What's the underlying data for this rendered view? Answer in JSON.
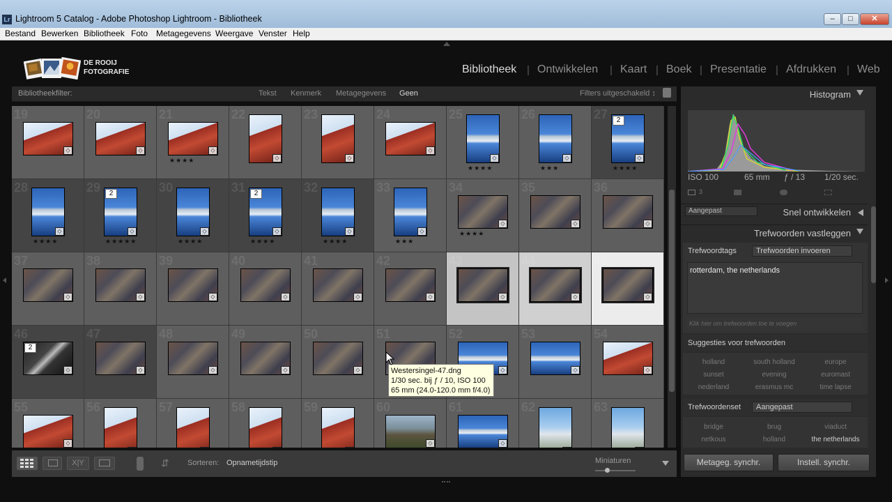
{
  "window": {
    "title": "Lightroom 5 Catalog - Adobe Photoshop Lightroom - Bibliotheek",
    "app_icon": "Lr"
  },
  "menu": [
    "Bestand",
    "Bewerken",
    "Bibliotheek",
    "Foto",
    "Metagegevens",
    "Weergave",
    "Venster",
    "Help"
  ],
  "identity": {
    "line1": "DE ROOIJ",
    "line2": "FOTOGRAFIE"
  },
  "modules": [
    "Bibliotheek",
    "Ontwikkelen",
    "Kaart",
    "Boek",
    "Presentatie",
    "Afdrukken",
    "Web"
  ],
  "active_module": "Bibliotheek",
  "filterbar": {
    "label": "Bibliotheekfilter:",
    "tabs": [
      "Tekst",
      "Kenmerk",
      "Metagegevens",
      "Geen"
    ],
    "active_tab": "Geen",
    "preset": "Filters uitgeschakeld ↕"
  },
  "grid": {
    "rows": [
      [
        {
          "n": "19",
          "style": "red",
          "orient": "land",
          "stars": "",
          "badge": ""
        },
        {
          "n": "20",
          "style": "red",
          "orient": "land",
          "stars": "",
          "badge": ""
        },
        {
          "n": "21",
          "style": "red",
          "orient": "land",
          "stars": "★★★★",
          "badge": ""
        },
        {
          "n": "22",
          "style": "red",
          "orient": "port",
          "stars": "",
          "badge": ""
        },
        {
          "n": "23",
          "style": "red",
          "orient": "port",
          "stars": "",
          "badge": ""
        },
        {
          "n": "24",
          "style": "red",
          "orient": "land",
          "stars": "",
          "badge": ""
        },
        {
          "n": "25",
          "style": "blue",
          "orient": "port",
          "stars": "★★★★",
          "badge": ""
        },
        {
          "n": "26",
          "style": "blue",
          "orient": "port",
          "stars": "★★★",
          "badge": ""
        },
        {
          "n": "27",
          "style": "blue",
          "orient": "port",
          "stars": "★★★★",
          "badge": "2"
        }
      ],
      [
        {
          "n": "28",
          "style": "blue",
          "orient": "port",
          "stars": "★★★★",
          "badge": ""
        },
        {
          "n": "29",
          "style": "blue",
          "orient": "port",
          "stars": "★★★★★",
          "badge": "2"
        },
        {
          "n": "30",
          "style": "blue",
          "orient": "port",
          "stars": "★★★★",
          "badge": ""
        },
        {
          "n": "31",
          "style": "blue",
          "orient": "port",
          "stars": "★★★★",
          "badge": "2"
        },
        {
          "n": "32",
          "style": "blue",
          "orient": "port",
          "stars": "★★★★",
          "badge": ""
        },
        {
          "n": "33",
          "style": "blue",
          "orient": "port",
          "stars": "★★★",
          "badge": ""
        },
        {
          "n": "34",
          "style": "glass",
          "orient": "land",
          "stars": "★★★★",
          "badge": ""
        },
        {
          "n": "35",
          "style": "glass",
          "orient": "land",
          "stars": "",
          "badge": ""
        },
        {
          "n": "36",
          "style": "glass",
          "orient": "land",
          "stars": "",
          "badge": ""
        }
      ],
      [
        {
          "n": "37",
          "style": "glass",
          "orient": "land",
          "stars": "",
          "badge": ""
        },
        {
          "n": "38",
          "style": "glass",
          "orient": "land",
          "stars": "",
          "badge": ""
        },
        {
          "n": "39",
          "style": "glass",
          "orient": "land",
          "stars": "",
          "badge": ""
        },
        {
          "n": "40",
          "style": "glass",
          "orient": "land",
          "stars": "",
          "badge": ""
        },
        {
          "n": "41",
          "style": "glass",
          "orient": "land",
          "stars": "",
          "badge": ""
        },
        {
          "n": "42",
          "style": "glass",
          "orient": "land",
          "stars": "",
          "badge": ""
        },
        {
          "n": "43",
          "style": "glass",
          "orient": "land",
          "stars": "",
          "badge": ""
        },
        {
          "n": "44",
          "style": "glass",
          "orient": "land",
          "stars": "",
          "badge": ""
        },
        {
          "n": "45",
          "style": "glass",
          "orient": "land",
          "stars": "",
          "badge": ""
        }
      ],
      [
        {
          "n": "46",
          "style": "dark",
          "orient": "land",
          "stars": "",
          "badge": "2"
        },
        {
          "n": "47",
          "style": "glass",
          "orient": "land",
          "stars": "",
          "badge": ""
        },
        {
          "n": "48",
          "style": "glass",
          "orient": "land",
          "stars": "",
          "badge": ""
        },
        {
          "n": "49",
          "style": "glass",
          "orient": "land",
          "stars": "",
          "badge": ""
        },
        {
          "n": "50",
          "style": "glass",
          "orient": "land",
          "stars": "",
          "badge": ""
        },
        {
          "n": "51",
          "style": "glass",
          "orient": "land",
          "stars": "",
          "badge": ""
        },
        {
          "n": "52",
          "style": "blue",
          "orient": "land",
          "stars": "",
          "badge": ""
        },
        {
          "n": "53",
          "style": "blue",
          "orient": "land",
          "stars": "",
          "badge": ""
        },
        {
          "n": "54",
          "style": "red",
          "orient": "land",
          "stars": "",
          "badge": ""
        }
      ],
      [
        {
          "n": "55",
          "style": "red",
          "orient": "land",
          "stars": "",
          "badge": ""
        },
        {
          "n": "56",
          "style": "red",
          "orient": "port",
          "stars": "",
          "badge": ""
        },
        {
          "n": "57",
          "style": "red",
          "orient": "port",
          "stars": "",
          "badge": ""
        },
        {
          "n": "58",
          "style": "red",
          "orient": "port",
          "stars": "",
          "badge": ""
        },
        {
          "n": "59",
          "style": "red",
          "orient": "port",
          "stars": "",
          "badge": ""
        },
        {
          "n": "60",
          "style": "street",
          "orient": "land",
          "stars": "",
          "badge": ""
        },
        {
          "n": "61",
          "style": "blue",
          "orient": "land",
          "stars": "",
          "badge": ""
        },
        {
          "n": "62",
          "style": "city",
          "orient": "port",
          "stars": "",
          "badge": ""
        },
        {
          "n": "63",
          "style": "city",
          "orient": "port",
          "stars": "",
          "badge": ""
        }
      ]
    ]
  },
  "tooltip": {
    "line1": "Westersingel-47.dng",
    "line2": "1/30 sec. bij ƒ / 10, ISO 100",
    "line3": "65 mm (24.0-120.0 mm f/4.0)"
  },
  "histogram": {
    "title": "Histogram",
    "iso": "ISO 100",
    "focal": "65 mm",
    "aperture": "ƒ / 13",
    "shutter": "1/20 sec.",
    "crop_count": "3"
  },
  "quickdev": {
    "title": "Snel ontwikkelen",
    "preset": "Aangepast"
  },
  "keywording": {
    "title": "Trefwoorden vastleggen",
    "tags_label": "Trefwoordtags",
    "tags_mode": "Trefwoorden invoeren",
    "keywords": "rotterdam, the netherlands",
    "hint": "Klik hier om trefwoorden toe te voegen",
    "suggestions_title": "Suggesties voor trefwoorden",
    "suggestions": [
      "holland",
      "south holland",
      "europe",
      "sunset",
      "evening",
      "euromast",
      "nederland",
      "erasmus mc",
      "time lapse"
    ],
    "set_label": "Trefwoordenset",
    "set_value": "Aangepast",
    "set_items": [
      "bridge",
      "brug",
      "viaduct",
      "netkous",
      "holland",
      "the netherlands"
    ],
    "set_active": "the netherlands"
  },
  "toolbar": {
    "sort_label": "Sorteren:",
    "sort_value": "Opnametijdstip",
    "thumbs_label": "Miniaturen",
    "thumb_size_fraction": 0.27
  },
  "sync": {
    "metadata": "Metageg. synchr.",
    "settings": "Instell. synchr."
  }
}
